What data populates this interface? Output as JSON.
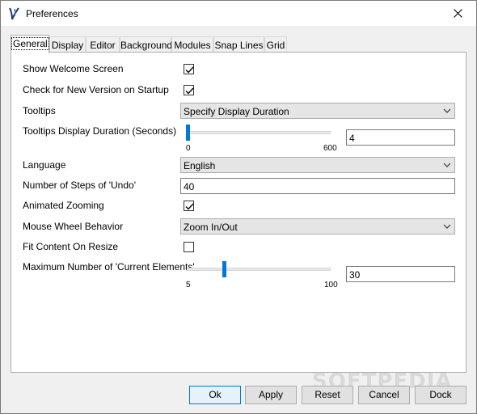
{
  "window": {
    "title": "Preferences"
  },
  "tabs": [
    "General",
    "Display",
    "Editor",
    "Background",
    "Modules",
    "Snap Lines",
    "Grid"
  ],
  "settings": {
    "show_welcome": {
      "label": "Show Welcome Screen",
      "checked": true
    },
    "check_version": {
      "label": "Check for New Version on Startup",
      "checked": true
    },
    "tooltips": {
      "label": "Tooltips",
      "value": "Specify Display Duration"
    },
    "tooltip_duration": {
      "label": "Tooltips Display Duration (Seconds)",
      "min": "0",
      "max": "600",
      "value": "4"
    },
    "language": {
      "label": "Language",
      "value": "English"
    },
    "undo_steps": {
      "label": "Number of Steps of 'Undo'",
      "value": "40"
    },
    "animated_zooming": {
      "label": "Animated Zooming",
      "checked": true
    },
    "mouse_wheel": {
      "label": "Mouse Wheel Behavior",
      "value": "Zoom In/Out"
    },
    "fit_content": {
      "label": "Fit Content On Resize",
      "checked": false
    },
    "max_current": {
      "label": "Maximum Number of 'Current Elements'",
      "min": "5",
      "max": "100",
      "value": "30"
    }
  },
  "buttons": {
    "ok": "Ok",
    "apply": "Apply",
    "reset": "Reset",
    "cancel": "Cancel",
    "dock": "Dock"
  },
  "watermark": "SOFTPEDIA",
  "colors": {
    "accent": "#0078d7"
  }
}
